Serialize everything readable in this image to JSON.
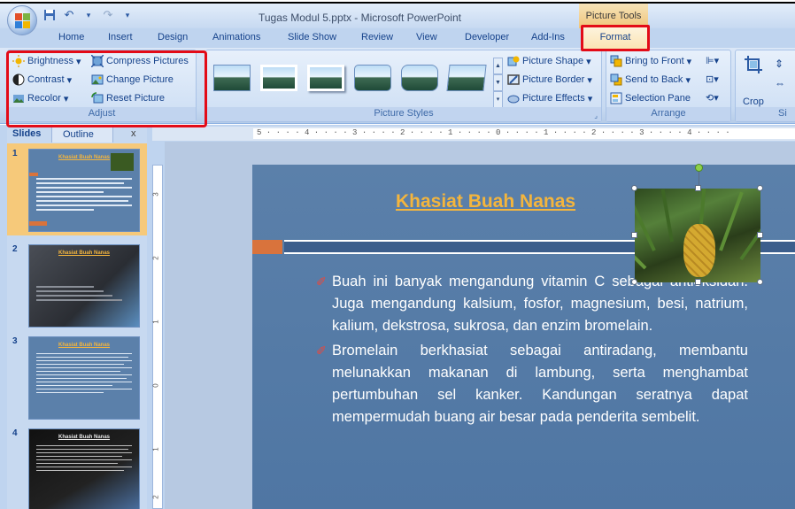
{
  "window": {
    "title": "Tugas Modul 5.pptx - Microsoft PowerPoint",
    "context_tab_group": "Picture Tools"
  },
  "quick_access": [
    "save-icon",
    "undo-icon",
    "redo-icon",
    "customize-icon"
  ],
  "tabs": [
    "Home",
    "Insert",
    "Design",
    "Animations",
    "Slide Show",
    "Review",
    "View",
    "Developer",
    "Add-Ins",
    "Format"
  ],
  "ribbon": {
    "adjust": {
      "label": "Adjust",
      "buttons": [
        "Brightness",
        "Contrast",
        "Recolor",
        "Compress Pictures",
        "Change Picture",
        "Reset Picture"
      ]
    },
    "picture_styles": {
      "label": "Picture Styles",
      "commands": [
        "Picture Shape",
        "Picture Border",
        "Picture Effects"
      ]
    },
    "arrange": {
      "label": "Arrange",
      "commands": [
        "Bring to Front",
        "Send to Back",
        "Selection Pane"
      ]
    },
    "size": {
      "label": "Si",
      "crop": "Crop"
    }
  },
  "slides_pane": {
    "tab_slides": "Slides",
    "tab_outline": "Outline",
    "close": "x",
    "slides": [
      {
        "number": "1",
        "title": "Khasiat Buah Nanas"
      },
      {
        "number": "2",
        "title": "Khasiat Buah Nanas"
      },
      {
        "number": "3",
        "title": "Khasiat Buah Nanas"
      },
      {
        "number": "4",
        "title": "Khasiat Buah Nanas"
      }
    ]
  },
  "ruler": {
    "horizontal": "5 · · · · 4 · · · · 3 · · · · 2 · · · · 1 · · · · 0 · · · · 1 · · · · 2 · · · · 3 · · · · 4 · · · ·",
    "vertical": [
      "3",
      "2",
      "1",
      "0",
      "1",
      "2"
    ]
  },
  "slide": {
    "title": "Khasiat Buah Nanas",
    "bullets": [
      "Buah ini banyak mengandung vitamin C sebagai antioksidan. Juga mengandung kalsium, fosfor, magnesium, besi, natrium, kalium, dekstrosa, sukrosa, dan enzim bromelain.",
      "Bromelain berkhasiat sebagai antiradang, membantu melunakkan makanan di lambung, serta menghambat pertumbuhan sel kanker. Kandungan seratnya dapat mempermudah buang air besar pada penderita sembelit."
    ]
  },
  "colors": {
    "highlight": "#e30b17",
    "slide_bg": "#5b80aa",
    "title": "#f4b53d",
    "accent_orange": "#d9733c"
  }
}
